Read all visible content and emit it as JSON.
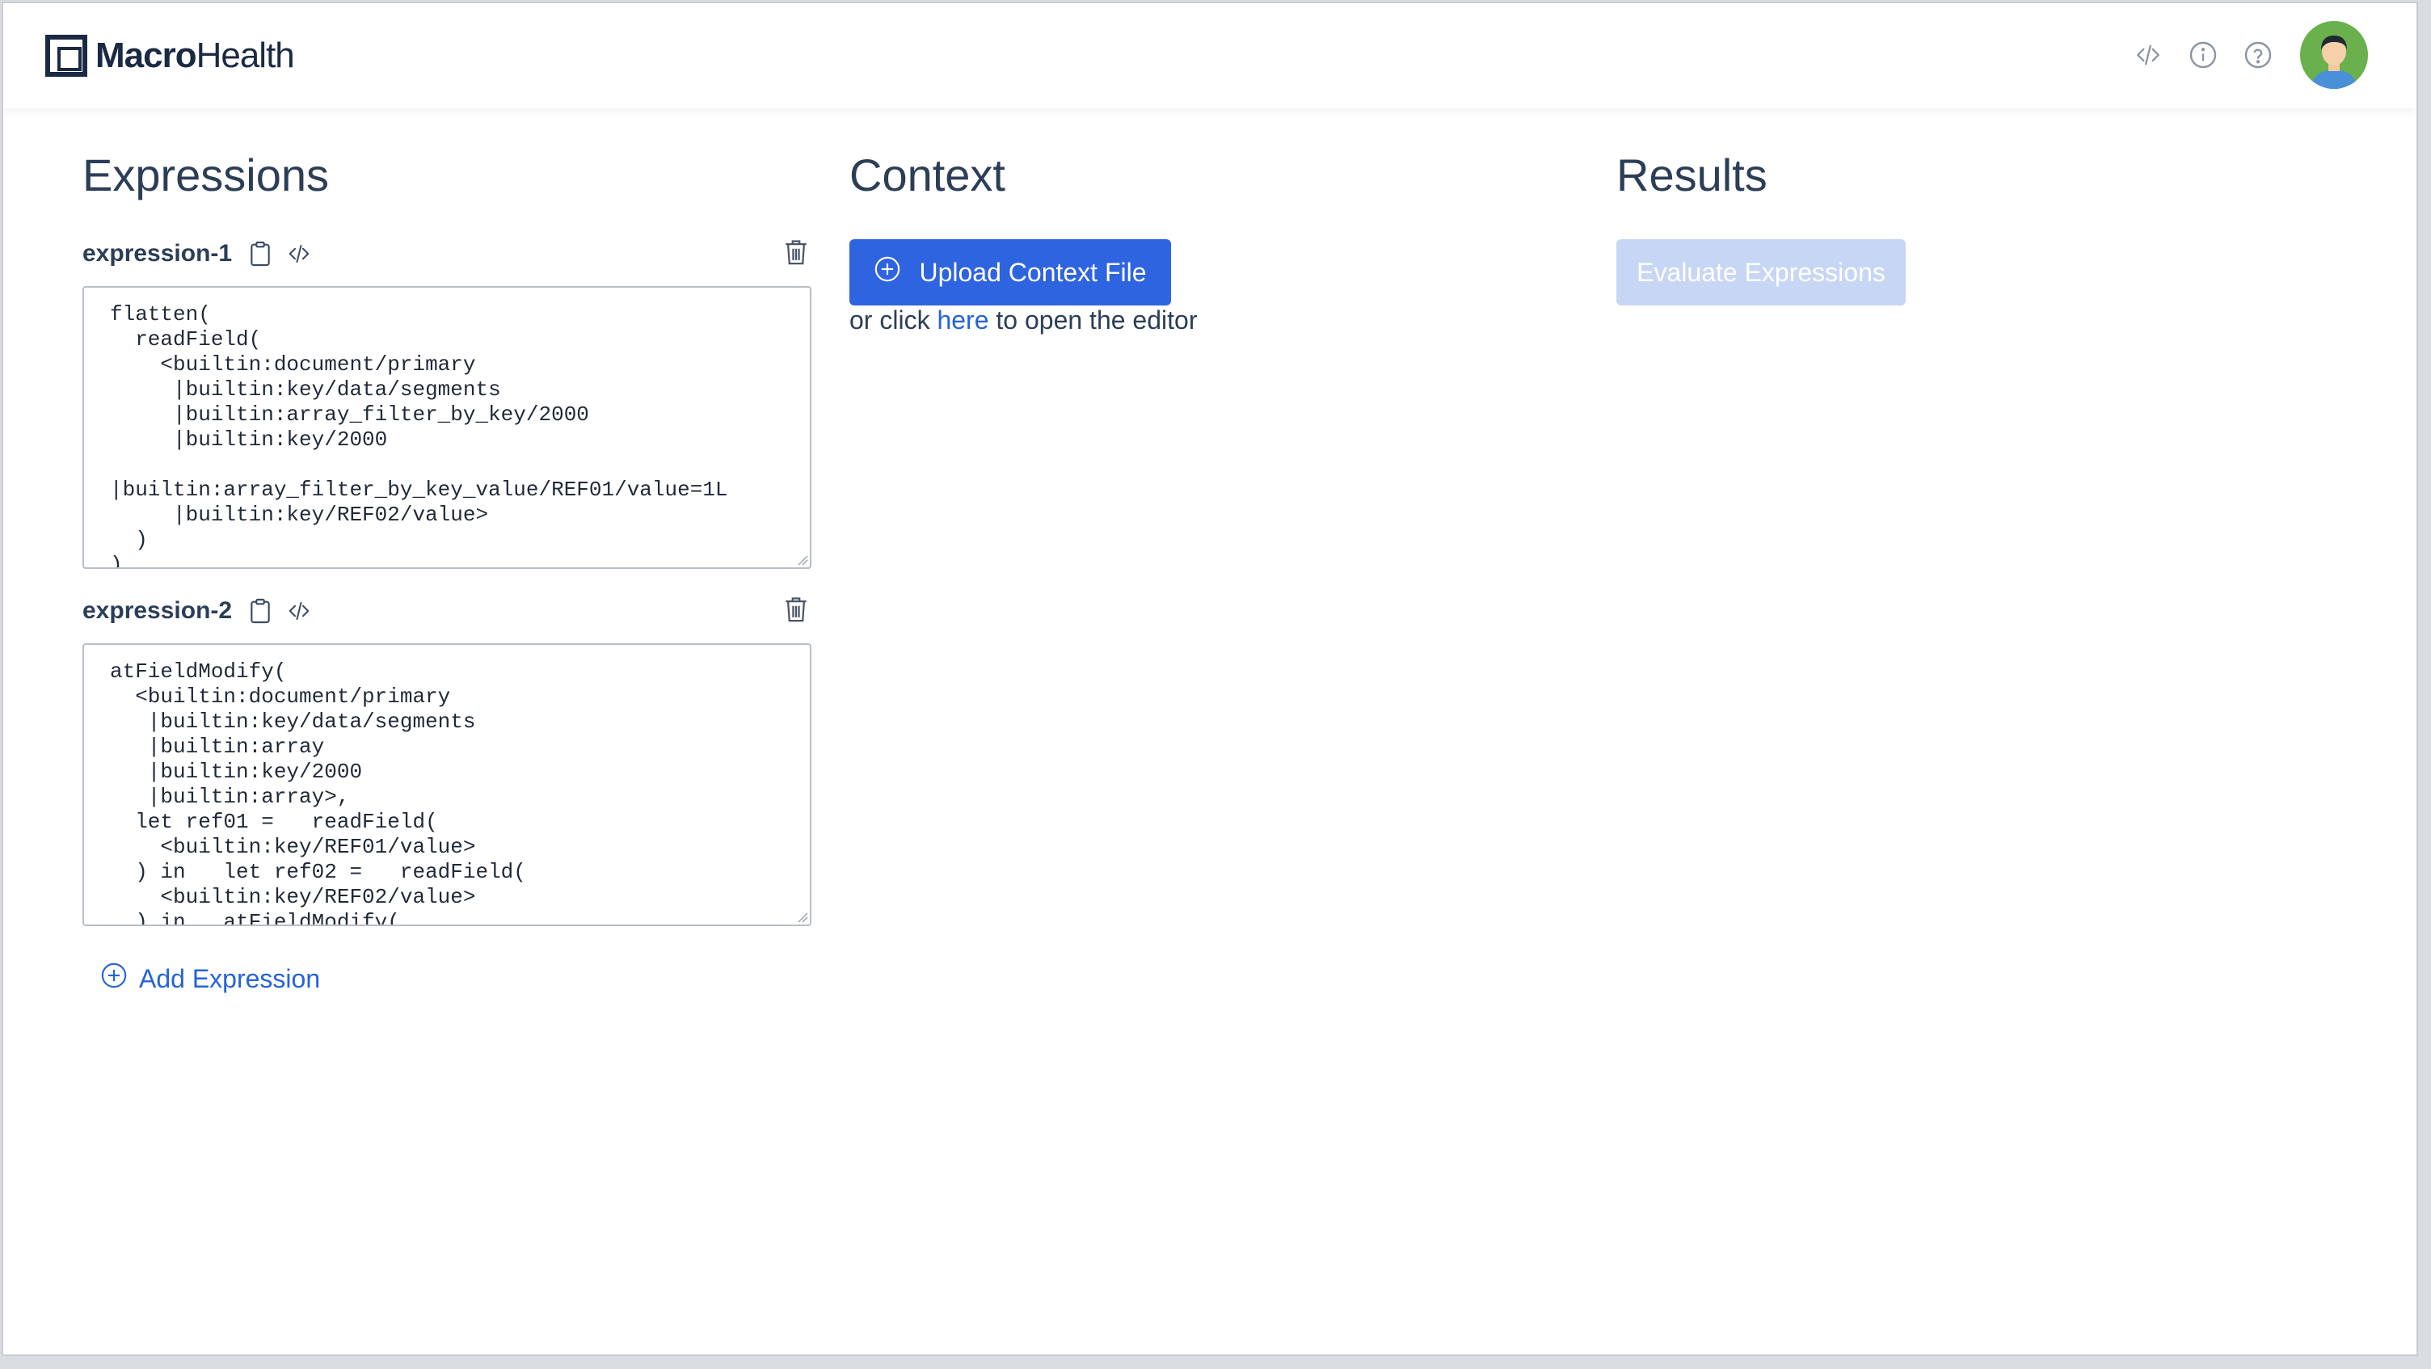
{
  "header": {
    "logo_bold": "Macro",
    "logo_light": "Health",
    "icons": [
      "code-icon",
      "info-icon",
      "help-icon"
    ]
  },
  "expressions": {
    "title": "Expressions",
    "items": [
      {
        "name": "expression-1",
        "code": "flatten(\n  readField(\n    <builtin:document/primary\n     |builtin:key/data/segments\n     |builtin:array_filter_by_key/2000\n     |builtin:key/2000\n\n|builtin:array_filter_by_key_value/REF01/value=1L\n     |builtin:key/REF02/value>\n  )\n)"
      },
      {
        "name": "expression-2",
        "code": "atFieldModify(\n  <builtin:document/primary\n   |builtin:key/data/segments\n   |builtin:array\n   |builtin:key/2000\n   |builtin:array>,\n  let ref01 =   readField(\n    <builtin:key/REF01/value>\n  ) in   let ref02 =   readField(\n    <builtin:key/REF02/value>\n  ) in   atFieldModify("
      }
    ],
    "add_label": "Add Expression"
  },
  "context": {
    "title": "Context",
    "upload_label": "Upload Context File",
    "or_click_prefix": "or click ",
    "link_text": "here",
    "or_click_suffix": " to open the editor"
  },
  "results": {
    "title": "Results",
    "evaluate_label": "Evaluate Expressions"
  },
  "colors": {
    "primary": "#2f64e0",
    "disabled": "#c8d6f6",
    "text": "#2c3e57",
    "link": "#2563d8"
  }
}
